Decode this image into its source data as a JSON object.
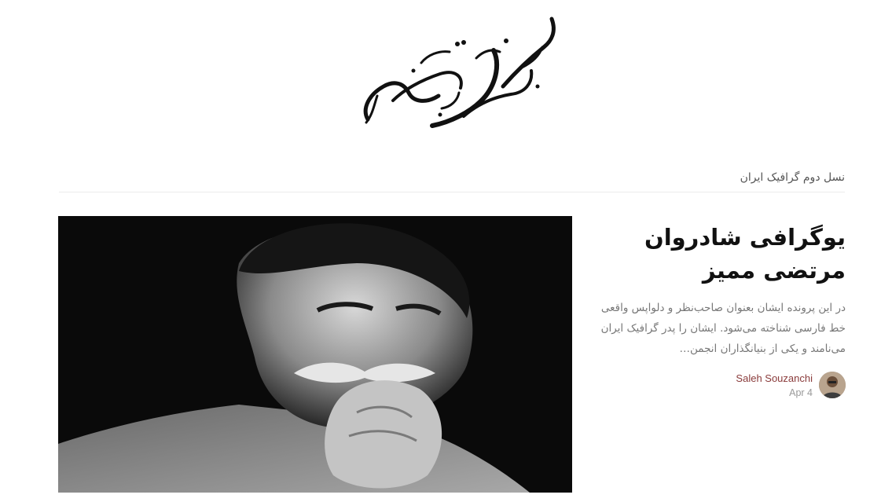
{
  "site": {
    "logo_text": "موزه گرافیک ایران"
  },
  "section": {
    "title": "نسل دوم گرافیک ایران"
  },
  "post": {
    "title_line1": "یوگرافی شادروان",
    "title_line2": "مرتضی ممیز",
    "excerpt": "در این پرونده ایشان بعنوان صاحب‌نظر و دلواپس واقعی خط فارسی شناخته می‌شود. ایشان را پدر گرافیک ایران می‌نامند و یکی از بنیانگذاران انجمن…",
    "author": "Saleh Souzanchi",
    "date": "Apr 4"
  }
}
